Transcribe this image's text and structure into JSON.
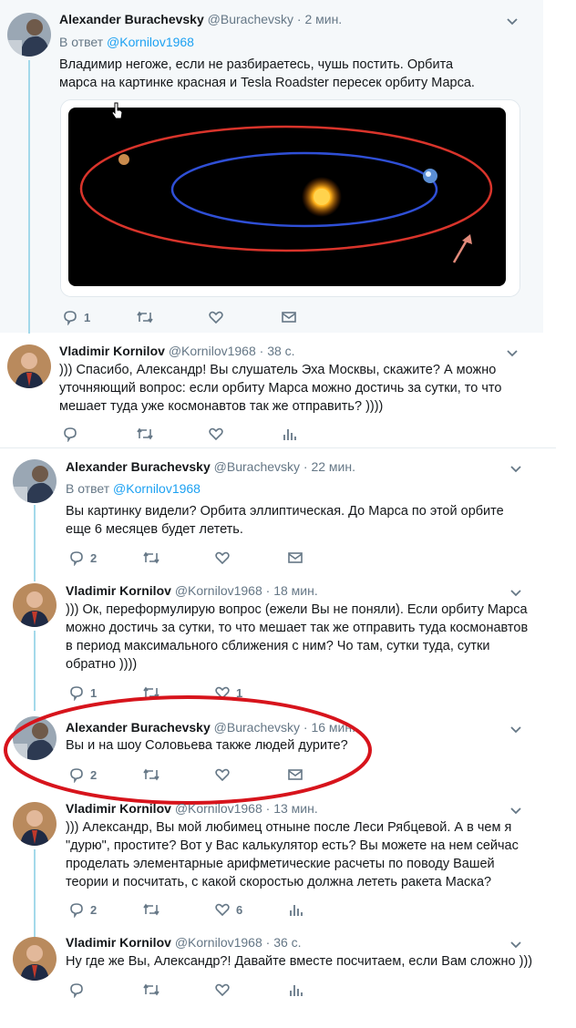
{
  "tweets": [
    {
      "name": "Alexander Burachevsky",
      "handle": "@Burachevsky",
      "time": "· 2 мин.",
      "reply_prefix": "В ответ",
      "reply_mention": "@Kornilov1968",
      "text": "Владимир негоже, если не разбираетесь, чушь постить. Орбита марса на картинке красная и Tesla Roadster пересек орбиту Марса.",
      "reply_count": "1",
      "retweet_count": "",
      "like_count": ""
    },
    {
      "name": "Vladimir Kornilov",
      "handle": "@Kornilov1968",
      "time": "· 38 с.",
      "text": "))) Спасибо, Александр! Вы слушатель Эха Москвы, скажите? А можно уточняющий вопрос: если орбиту Марса можно достичь за сутки, то что мешает туда уже космонавтов так же отправить? ))))",
      "reply_count": "",
      "retweet_count": "",
      "like_count": ""
    },
    {
      "name": "Alexander Burachevsky",
      "handle": "@Burachevsky",
      "time": "· 22 мин.",
      "reply_prefix": "В ответ",
      "reply_mention": "@Kornilov1968",
      "text": "Вы картинку видели? Орбита эллиптическая. До Марса по этой орбите еще 6 месяцев будет лететь.",
      "reply_count": "2",
      "retweet_count": "",
      "like_count": ""
    },
    {
      "name": "Vladimir Kornilov",
      "handle": "@Kornilov1968",
      "time": "· 18 мин.",
      "text": "))) Ок, переформулирую вопрос (ежели Вы не поняли). Если орбиту Марса можно достичь за сутки, то что мешает так же отправить туда космонавтов в период максимального сближения с ним? Чо там, сутки туда, сутки обратно ))))",
      "reply_count": "1",
      "retweet_count": "",
      "like_count": "1"
    },
    {
      "name": "Alexander Burachevsky",
      "handle": "@Burachevsky",
      "time": "· 16 мин.",
      "text": "Вы и на шоу Соловьева также людей дурите?",
      "reply_count": "2",
      "retweet_count": "",
      "like_count": ""
    },
    {
      "name": "Vladimir Kornilov",
      "handle": "@Kornilov1968",
      "time": "· 13 мин.",
      "text": "))) Александр, Вы мой любимец отныне после Леси Рябцевой. А в чем я \"дурю\", простите? Вот у Вас калькулятор есть? Вы можете на нем сейчас проделать элементарные арифметические расчеты по поводу Вашей теории и посчитать, с какой скоростью должна лететь ракета Маска?",
      "reply_count": "2",
      "retweet_count": "",
      "like_count": "6"
    },
    {
      "name": "Vladimir Kornilov",
      "handle": "@Kornilov1968",
      "time": "· 36 с.",
      "text": "Ну где же Вы, Александр?! Давайте вместе посчитаем, если Вам сложно )))",
      "reply_count": "",
      "retweet_count": "",
      "like_count": ""
    }
  ],
  "icons": {
    "reply": "reply-icon",
    "retweet": "retweet-icon",
    "like": "heart-icon",
    "dm": "envelope-icon",
    "analytics": "analytics-icon",
    "more": "chevron-down-icon"
  },
  "colors": {
    "thread_line": "#a4d9ea",
    "link": "#1da1f2",
    "annotation": "#d7141c",
    "mars_orbit": "#d9342b",
    "earth_orbit": "#2f4fd6"
  }
}
